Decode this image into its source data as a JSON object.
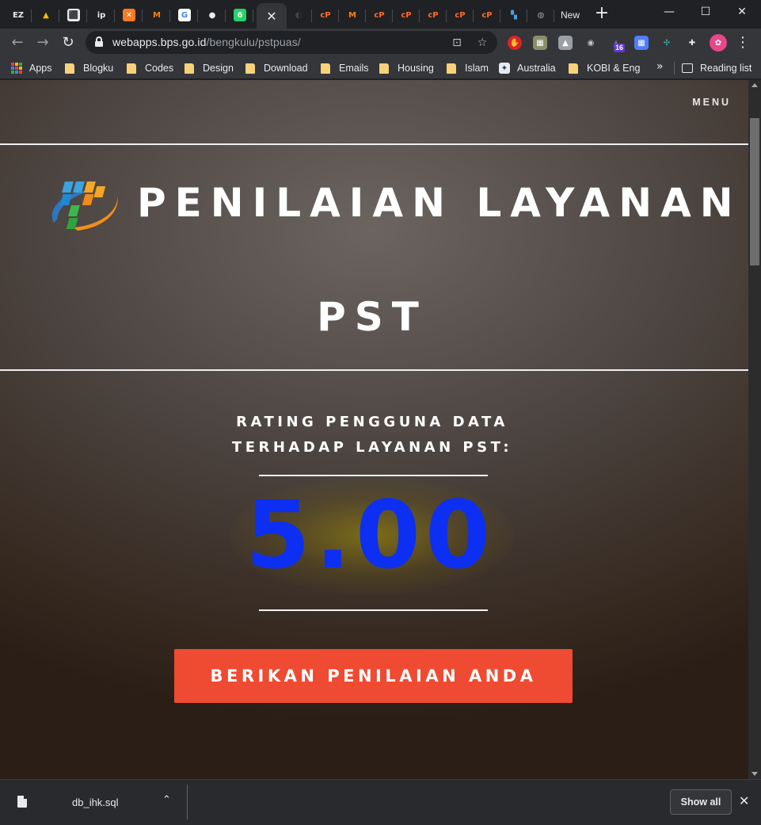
{
  "browser": {
    "tabs": [
      {
        "icon": "ezoic-icon",
        "glyph": "EZ",
        "color": "#202124",
        "fg": "#e8eaed",
        "active": false
      },
      {
        "icon": "google-drive-icon",
        "glyph": "▲",
        "color": "#202124",
        "fg": "#fbbc04",
        "active": false
      },
      {
        "icon": "site-icon",
        "glyph": "⬛",
        "color": "#e8eaed",
        "fg": "#1a73e8",
        "active": false
      },
      {
        "icon": "ip-icon",
        "glyph": "ip",
        "color": "#202124",
        "fg": "#e8eaed",
        "active": false
      },
      {
        "icon": "xampp-icon",
        "glyph": "✕",
        "color": "#fb7a24",
        "fg": "#ffffff",
        "active": false
      },
      {
        "icon": "moodle-icon",
        "glyph": "M",
        "color": "#202124",
        "fg": "#f98012",
        "active": false
      },
      {
        "icon": "google-icon",
        "glyph": "G",
        "color": "#ffffff",
        "fg": "#4285f4",
        "active": false
      },
      {
        "icon": "github-icon",
        "glyph": "●",
        "color": "#202124",
        "fg": "#e8eaed",
        "active": false
      },
      {
        "icon": "whatsapp-icon",
        "glyph": "6",
        "color": "#25d366",
        "fg": "#ffffff",
        "active": false
      },
      {
        "icon": "tab-close-icon",
        "glyph": "✕",
        "color": "",
        "fg": "#e8eaed",
        "active": true
      },
      {
        "icon": "dark-site-icon",
        "glyph": "◐",
        "color": "#202124",
        "fg": "#444",
        "active": false
      },
      {
        "icon": "cpanel-icon",
        "glyph": "cP",
        "color": "#202124",
        "fg": "#ff6c2c",
        "active": false
      },
      {
        "icon": "moodle-icon",
        "glyph": "M",
        "color": "#202124",
        "fg": "#f98012",
        "active": false
      },
      {
        "icon": "cpanel-icon",
        "glyph": "cP",
        "color": "#202124",
        "fg": "#ff6c2c",
        "active": false
      },
      {
        "icon": "cpanel-icon",
        "glyph": "cP",
        "color": "#202124",
        "fg": "#ff6c2c",
        "active": false
      },
      {
        "icon": "cpanel-icon",
        "glyph": "cP",
        "color": "#202124",
        "fg": "#ff6c2c",
        "active": false
      },
      {
        "icon": "cpanel-icon",
        "glyph": "cP",
        "color": "#202124",
        "fg": "#ff6c2c",
        "active": false
      },
      {
        "icon": "cpanel-icon",
        "glyph": "cP",
        "color": "#202124",
        "fg": "#ff6c2c",
        "active": false
      },
      {
        "icon": "bps-icon",
        "glyph": "▚",
        "color": "#202124",
        "fg": "#4aa3df",
        "active": false
      },
      {
        "icon": "globe-icon",
        "glyph": "◍",
        "color": "#202124",
        "fg": "#9aa0a6",
        "active": false
      }
    ],
    "last_tab_label": "New",
    "url_host": "webapps.bps.go.id",
    "url_path": "/bengkulu/pstpuas/",
    "bookmarks": [
      {
        "label": "Apps",
        "type": "apps"
      },
      {
        "label": "Blogku",
        "type": "folder"
      },
      {
        "label": "Codes",
        "type": "folder"
      },
      {
        "label": "Design",
        "type": "folder"
      },
      {
        "label": "Download",
        "type": "folder"
      },
      {
        "label": "Emails",
        "type": "folder"
      },
      {
        "label": "Housing",
        "type": "folder"
      },
      {
        "label": "Islam",
        "type": "folder"
      },
      {
        "label": "Australia",
        "type": "site"
      },
      {
        "label": "KOBI & Eng",
        "type": "folder"
      }
    ],
    "bookmarks_more": "»",
    "reading_list": "Reading list",
    "extension_badge": "16"
  },
  "page": {
    "menu": "MENU",
    "title_line1": "PENILAIAN LAYANAN",
    "title_line2": "PST",
    "rating_label_line1": "RATING PENGGUNA DATA",
    "rating_label_line2": "TERHADAP LAYANAN PST:",
    "score": "5.00",
    "cta": "BERIKAN PENILAIAN ANDA",
    "colors": {
      "score": "#0c2ff1",
      "cta": "#ee4b32"
    }
  },
  "downloads": {
    "file_name": "db_ihk.sql",
    "show_all": "Show all"
  }
}
